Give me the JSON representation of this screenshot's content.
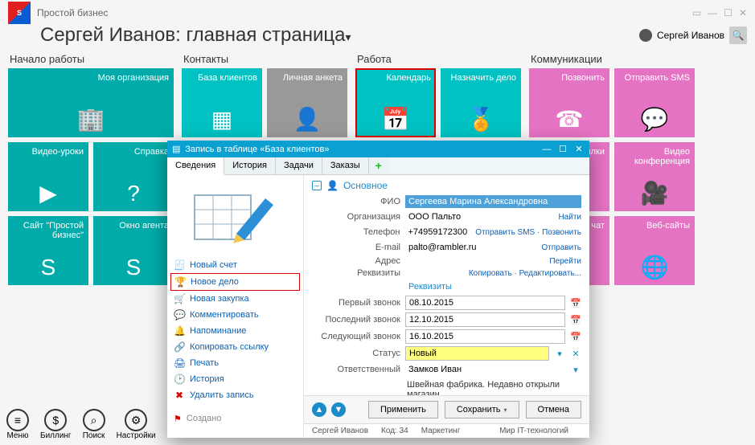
{
  "app": {
    "small_title": "Простой бизнес"
  },
  "page": {
    "title": "Сергей Иванов: главная страница"
  },
  "user": {
    "name": "Сергей Иванов"
  },
  "sections": {
    "start": {
      "title": "Начало работы",
      "tiles": [
        "Моя организация",
        "Видео-уроки",
        "Справка",
        "Сайт \"Простой бизнес\"",
        "Окно агента"
      ]
    },
    "contacts": {
      "title": "Контакты",
      "tiles": [
        "База клиентов",
        "Личная анкета"
      ]
    },
    "work": {
      "title": "Работа",
      "tiles": [
        "Календарь",
        "Назначить дело"
      ]
    },
    "comm": {
      "title": "Коммуникации",
      "tiles": [
        "Позвонить",
        "Отправить SMS",
        "Рассылки",
        "Видео конференция",
        "Общий чат",
        "Веб-сайты"
      ]
    }
  },
  "bottom": [
    "Меню",
    "Биллинг",
    "Поиск",
    "Настройки"
  ],
  "dialog": {
    "title": "Запись в таблице «База клиентов»",
    "tabs": [
      "Сведения",
      "История",
      "Задачи",
      "Заказы"
    ],
    "left_actions": [
      "Новый счет",
      "Новое дело",
      "Новая закупка",
      "Комментировать",
      "Напоминание",
      "Копировать ссылку",
      "Печать",
      "История",
      "Удалить запись"
    ],
    "created_label": "Создано",
    "group_main": "Основное",
    "fields": {
      "fio": {
        "label": "ФИО",
        "value": "Сергеева Марина Александровна"
      },
      "org": {
        "label": "Организация",
        "value": "ООО Пальто",
        "action": "Найти"
      },
      "phone": {
        "label": "Телефон",
        "value": "+74959172300",
        "action": "Отправить SMS · Позвонить"
      },
      "email": {
        "label": "E-mail",
        "value": "palto@rambler.ru",
        "action": "Отправить"
      },
      "addr": {
        "label": "Адрес",
        "value": "",
        "action": "Перейти"
      },
      "req": {
        "label": "Реквизиты",
        "value": "",
        "action": "Копировать · Редактировать..."
      }
    },
    "sub_header": "Реквизиты",
    "calls": {
      "first": {
        "label": "Первый звонок",
        "value": "08.10.2015"
      },
      "last": {
        "label": "Последний звонок",
        "value": "12.10.2015"
      },
      "next": {
        "label": "Следующий звонок",
        "value": "16.10.2015"
      }
    },
    "status": {
      "label": "Статус",
      "value": "Новый"
    },
    "resp": {
      "label": "Ответственный",
      "value": "Замков Иван"
    },
    "note": "Швейная фабрика. Недавно открыли магазин",
    "buttons": {
      "apply": "Применить",
      "save": "Сохранить",
      "cancel": "Отмена"
    },
    "status_bar": {
      "user": "Сергей Иванов",
      "code": "Код: 34",
      "dept": "Маркетинг",
      "owner": "Мир IT-технологий"
    }
  }
}
